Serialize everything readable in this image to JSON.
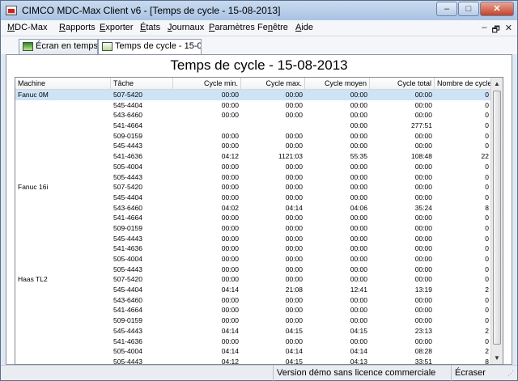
{
  "window": {
    "title": "CIMCO MDC-Max Client v6 - [Temps de cycle - 15-08-2013]",
    "minimize": "–",
    "maximize": "□",
    "close": "✕"
  },
  "menu": {
    "items": [
      {
        "pre": "",
        "ul": "M",
        "post": "DC-Max"
      },
      {
        "pre": "",
        "ul": "R",
        "post": "apports"
      },
      {
        "pre": "",
        "ul": "E",
        "post": "xporter"
      },
      {
        "pre": "",
        "ul": "É",
        "post": "tats"
      },
      {
        "pre": "",
        "ul": "J",
        "post": "ournaux"
      },
      {
        "pre": "",
        "ul": "P",
        "post": "aramètres"
      },
      {
        "pre": "Fe",
        "ul": "n",
        "post": "être"
      },
      {
        "pre": "",
        "ul": "A",
        "post": "ide"
      }
    ],
    "mdi_minimize": "–",
    "mdi_restore": "🗗",
    "mdi_close": "✕"
  },
  "tabs": [
    {
      "label": "Écran en temps réel",
      "active": false
    },
    {
      "label": "Temps de cycle - 15-08-2013",
      "active": true
    }
  ],
  "report": {
    "title": "Temps de cycle - 15-08-2013",
    "columns": [
      "Machine",
      "Tâche",
      "Cycle min.",
      "Cycle max.",
      "Cycle moyen",
      "Cycle total",
      "Nombre de cycles"
    ],
    "rows": [
      [
        "Fanuc 0M",
        "507-5420",
        "00:00",
        "00:00",
        "00:00",
        "00:00",
        "0"
      ],
      [
        "",
        "545-4404",
        "00:00",
        "00:00",
        "00:00",
        "00:00",
        "0"
      ],
      [
        "",
        "543-6460",
        "00:00",
        "00:00",
        "00:00",
        "00:00",
        "0"
      ],
      [
        "",
        "541-4664",
        "",
        "",
        "00:00",
        "277:51",
        "0"
      ],
      [
        "",
        "509-0159",
        "00:00",
        "00:00",
        "00:00",
        "00:00",
        "0"
      ],
      [
        "",
        "545-4443",
        "00:00",
        "00:00",
        "00:00",
        "00:00",
        "0"
      ],
      [
        "",
        "541-4636",
        "04:12",
        "1121:03",
        "55:35",
        "108:48",
        "22"
      ],
      [
        "",
        "505-4004",
        "00:00",
        "00:00",
        "00:00",
        "00:00",
        "0"
      ],
      [
        "",
        "505-4443",
        "00:00",
        "00:00",
        "00:00",
        "00:00",
        "0"
      ],
      [
        "Fanuc 16i",
        "507-5420",
        "00:00",
        "00:00",
        "00:00",
        "00:00",
        "0"
      ],
      [
        "",
        "545-4404",
        "00:00",
        "00:00",
        "00:00",
        "00:00",
        "0"
      ],
      [
        "",
        "543-6460",
        "04:02",
        "04:14",
        "04:06",
        "35:24",
        "8"
      ],
      [
        "",
        "541-4664",
        "00:00",
        "00:00",
        "00:00",
        "00:00",
        "0"
      ],
      [
        "",
        "509-0159",
        "00:00",
        "00:00",
        "00:00",
        "00:00",
        "0"
      ],
      [
        "",
        "545-4443",
        "00:00",
        "00:00",
        "00:00",
        "00:00",
        "0"
      ],
      [
        "",
        "541-4636",
        "00:00",
        "00:00",
        "00:00",
        "00:00",
        "0"
      ],
      [
        "",
        "505-4004",
        "00:00",
        "00:00",
        "00:00",
        "00:00",
        "0"
      ],
      [
        "",
        "505-4443",
        "00:00",
        "00:00",
        "00:00",
        "00:00",
        "0"
      ],
      [
        "Haas TL2",
        "507-5420",
        "00:00",
        "00:00",
        "00:00",
        "00:00",
        "0"
      ],
      [
        "",
        "545-4404",
        "04:14",
        "21:08",
        "12:41",
        "13:19",
        "2"
      ],
      [
        "",
        "543-6460",
        "00:00",
        "00:00",
        "00:00",
        "00:00",
        "0"
      ],
      [
        "",
        "541-4664",
        "00:00",
        "00:00",
        "00:00",
        "00:00",
        "0"
      ],
      [
        "",
        "509-0159",
        "00:00",
        "00:00",
        "00:00",
        "00:00",
        "0"
      ],
      [
        "",
        "545-4443",
        "04:14",
        "04:15",
        "04:15",
        "23:13",
        "2"
      ],
      [
        "",
        "541-4636",
        "00:00",
        "00:00",
        "00:00",
        "00:00",
        "0"
      ],
      [
        "",
        "505-4004",
        "04:14",
        "04:14",
        "04:14",
        "08:28",
        "2"
      ],
      [
        "",
        "505-4443",
        "04:12",
        "04:15",
        "04:13",
        "33:51",
        "8"
      ]
    ]
  },
  "status": {
    "message": "Version démo sans licence commerciale",
    "mode": "Écraser"
  },
  "colors": {
    "selected_row": "#cfe3f7",
    "titlebar": "#a9c3e3"
  }
}
